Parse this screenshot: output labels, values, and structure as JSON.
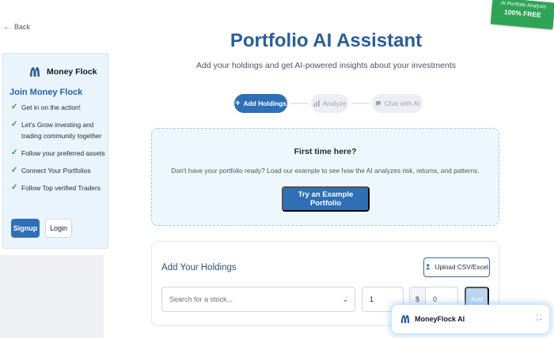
{
  "back": {
    "label": "Back"
  },
  "ribbon": {
    "line1": "AI Portfolio Analysis",
    "line2": "100% FREE"
  },
  "sidebar": {
    "brand": "Money Flock",
    "join_title": "Join Money Flock",
    "perks": [
      "Get in on the action!",
      "Let's Grow investing and trading community together",
      "Follow your preferred assets",
      "Connect Your Portfolios",
      "Follow Top verified Traders"
    ],
    "signup_label": "Signup",
    "login_label": "Login"
  },
  "header": {
    "title": "Portfolio AI Assistant",
    "subtitle": "Add your holdings and get AI-powered insights about your investments"
  },
  "steps": [
    {
      "label": "Add Holdings",
      "icon": "plus-icon",
      "active": true
    },
    {
      "label": "Analyze",
      "icon": "chart-icon",
      "active": false
    },
    {
      "label": "Chat with AI",
      "icon": "chat-icon",
      "active": false
    }
  ],
  "callout": {
    "title": "First time here?",
    "text": "Don't have your portfolio ready? Load our example to see how the AI analyzes risk, returns, and patterns.",
    "cta": "Try an Example Portfolio"
  },
  "holdings": {
    "title": "Add Your Holdings",
    "upload_label": "Upload CSV/Excel",
    "search_placeholder": "Search for a stock...",
    "quantity": "1",
    "currency": "$",
    "price": "0",
    "add_label": "Add"
  },
  "chat": {
    "name": "MoneyFlock AI"
  },
  "colors": {
    "primary": "#2f6fb5",
    "title": "#2a5d95",
    "success": "#16a34a",
    "ribbon": "#2fa356"
  }
}
